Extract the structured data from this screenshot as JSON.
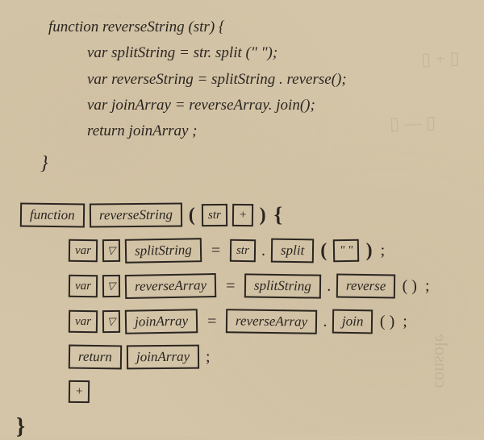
{
  "handwritten_code": {
    "line1": "function reverseString (str) {",
    "line2": "var splitString = str. split (\" \");",
    "line3": "var reverseString = splitString . reverse();",
    "line4": "var joinArray = reverseArray. join();",
    "line5": "return joinArray ;",
    "close": "}"
  },
  "block_editor": {
    "row1": {
      "keyword": "function",
      "name": "reverseString",
      "param": "str",
      "add": "+"
    },
    "row2": {
      "keyword": "var",
      "dropdown": "▽",
      "varname": "splitString",
      "obj": "str",
      "method": "split",
      "arg": "\" \""
    },
    "row3": {
      "keyword": "var",
      "dropdown": "▽",
      "varname": "reverseArray",
      "obj": "splitString",
      "method": "reverse"
    },
    "row4": {
      "keyword": "var",
      "dropdown": "▽",
      "varname": "joinArray",
      "obj": "reverseArray",
      "method": "join"
    },
    "row5": {
      "keyword": "return",
      "value": "joinArray"
    },
    "row6": {
      "add": "+"
    },
    "close": "}"
  },
  "symbols": {
    "lparen": "(",
    "rparen": ")",
    "lbrace": "{",
    "dot": ".",
    "eq": "=",
    "semi": ";",
    "empty_parens": "( )"
  }
}
